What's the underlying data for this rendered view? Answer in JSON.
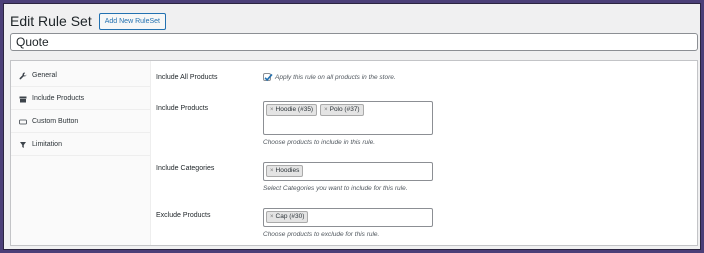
{
  "header": {
    "title": "Edit Rule Set",
    "add_new_label": "Add New RuleSet"
  },
  "rule_title": "Quote",
  "tabs": [
    {
      "label": "General",
      "icon": "wrench-icon"
    },
    {
      "label": "Include Products",
      "icon": "box-icon"
    },
    {
      "label": "Custom Button",
      "icon": "button-icon"
    },
    {
      "label": "Limitation",
      "icon": "filter-icon"
    }
  ],
  "fields": {
    "include_all": {
      "label": "Include All Products",
      "checked": true,
      "description": "Apply this rule on all products in the store."
    },
    "include_products": {
      "label": "Include Products",
      "chips": [
        "Hoodie (#35)",
        "Polo (#37)"
      ],
      "description": "Choose products to include in this rule."
    },
    "include_categories": {
      "label": "Include Categories",
      "chips": [
        "Hoodies"
      ],
      "description": "Select Categories you want to include for this rule."
    },
    "exclude_products": {
      "label": "Exclude Products",
      "chips": [
        "Cap (#30)"
      ],
      "description": "Choose products to exclude for this rule."
    }
  },
  "chip_remove_symbol": "×",
  "colors": {
    "accent": "#2271b1",
    "frame": "#4b3f78",
    "background": "#f0f0f1"
  }
}
